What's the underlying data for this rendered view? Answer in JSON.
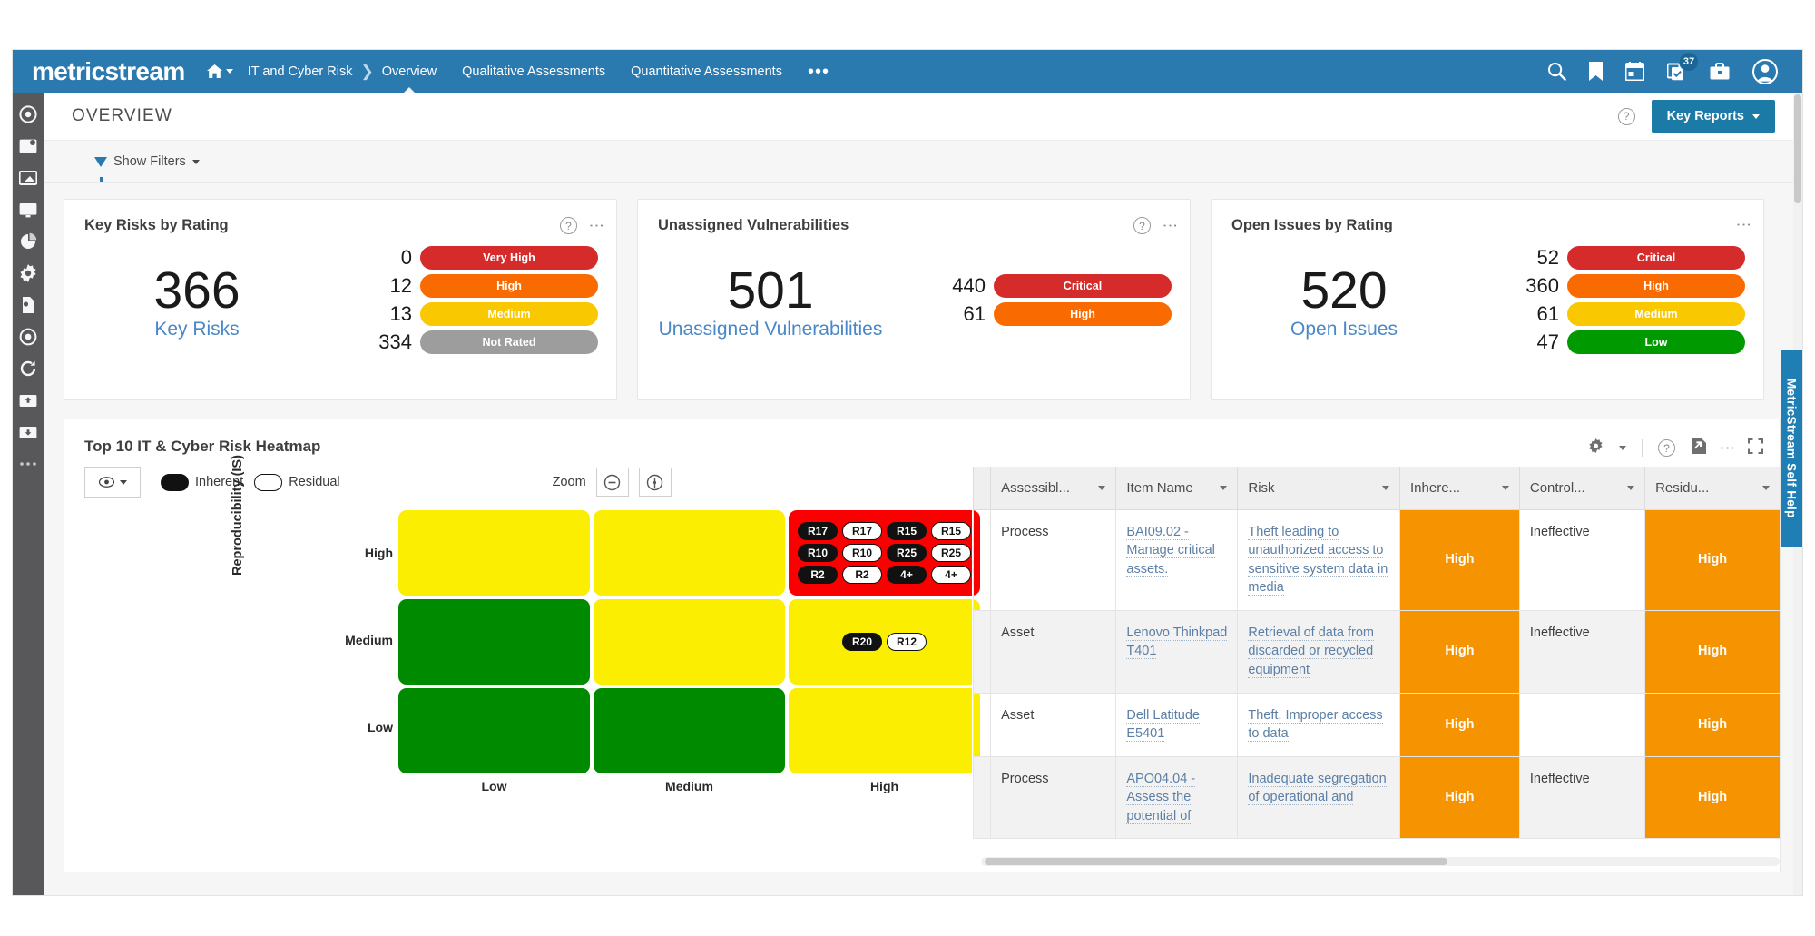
{
  "topbar": {
    "brand": "metricstream",
    "home_icon": "home-icon",
    "breadcrumb_root": "IT and Cyber Risk",
    "nav": [
      {
        "label": "Overview",
        "active": true
      },
      {
        "label": "Qualitative Assessments",
        "active": false
      },
      {
        "label": "Quantitative Assessments",
        "active": false
      }
    ],
    "more_label": "•••",
    "icons": [
      "search-icon",
      "bookmark-icon",
      "calendar-icon",
      "tasks-icon",
      "briefcase-icon",
      "user-avatar-icon"
    ],
    "task_badge": "37"
  },
  "page": {
    "title": "OVERVIEW",
    "help_label": "?",
    "key_reports_label": "Key Reports",
    "filters_label": "Show Filters"
  },
  "kpi_cards": [
    {
      "title": "Key Risks by Rating",
      "total": "366",
      "total_label": "Key Risks",
      "has_help": true,
      "bars": [
        {
          "value": "0",
          "label": "Very High",
          "color": "#d52b2b"
        },
        {
          "value": "12",
          "label": "High",
          "color": "#f96a00"
        },
        {
          "value": "13",
          "label": "Medium",
          "color": "#fac800"
        },
        {
          "value": "334",
          "label": "Not Rated",
          "color": "#9d9d9d"
        }
      ]
    },
    {
      "title": "Unassigned Vulnerabilities",
      "total": "501",
      "total_label": "Unassigned Vulnerabilities",
      "has_help": true,
      "bars": [
        {
          "value": "440",
          "label": "Critical",
          "color": "#d52b2b"
        },
        {
          "value": "61",
          "label": "High",
          "color": "#f96a00"
        }
      ]
    },
    {
      "title": "Open Issues by Rating",
      "total": "520",
      "total_label": "Open Issues",
      "has_help": false,
      "bars": [
        {
          "value": "52",
          "label": "Critical",
          "color": "#d52b2b"
        },
        {
          "value": "360",
          "label": "High",
          "color": "#f96a00"
        },
        {
          "value": "61",
          "label": "Medium",
          "color": "#fac800"
        },
        {
          "value": "47",
          "label": "Low",
          "color": "#009900"
        }
      ]
    }
  ],
  "heatmap_panel": {
    "title": "Top 10 IT & Cyber Risk Heatmap",
    "legend_inherent": "Inherent",
    "legend_residual": "Residual",
    "zoom_label": "Zoom",
    "zoom_out_icon": "zoom-out-icon",
    "zoom_reset_icon": "zoom-reset-icon",
    "eye_icon": "eye-icon",
    "tools": [
      "gear-icon",
      "help-icon",
      "export-icon",
      "kebab-icon",
      "fullscreen-icon"
    ]
  },
  "chart_data": {
    "type": "heatmap",
    "title": "Top 10 IT & Cyber Risk Heatmap",
    "ylabel": "Reproducibility (IS)",
    "xlabel": "",
    "y_categories": [
      "High",
      "Medium",
      "Low"
    ],
    "x_categories": [
      "Low",
      "Medium",
      "High"
    ],
    "legend": [
      "Inherent",
      "Residual"
    ],
    "cells": [
      {
        "row": "High",
        "col": "Low",
        "color": "#fbee00",
        "markers": []
      },
      {
        "row": "High",
        "col": "Medium",
        "color": "#fbee00",
        "markers": []
      },
      {
        "row": "High",
        "col": "High",
        "color": "#fb0000",
        "markers": [
          {
            "label": "R17",
            "type": "inherent"
          },
          {
            "label": "R17",
            "type": "residual"
          },
          {
            "label": "R15",
            "type": "inherent"
          },
          {
            "label": "R15",
            "type": "residual"
          },
          {
            "label": "R10",
            "type": "inherent"
          },
          {
            "label": "R10",
            "type": "residual"
          },
          {
            "label": "R25",
            "type": "inherent"
          },
          {
            "label": "R25",
            "type": "residual"
          },
          {
            "label": "R2",
            "type": "inherent"
          },
          {
            "label": "R2",
            "type": "residual"
          },
          {
            "label": "4+",
            "type": "inherent"
          },
          {
            "label": "4+",
            "type": "residual"
          }
        ]
      },
      {
        "row": "Medium",
        "col": "Low",
        "color": "#008a00",
        "markers": []
      },
      {
        "row": "Medium",
        "col": "Medium",
        "color": "#fbee00",
        "markers": []
      },
      {
        "row": "Medium",
        "col": "High",
        "color": "#fbee00",
        "markers": [
          {
            "label": "R20",
            "type": "inherent"
          },
          {
            "label": "R12",
            "type": "residual"
          }
        ]
      },
      {
        "row": "Low",
        "col": "Low",
        "color": "#008a00",
        "markers": []
      },
      {
        "row": "Low",
        "col": "Medium",
        "color": "#008a00",
        "markers": []
      },
      {
        "row": "Low",
        "col": "High",
        "color": "#fbee00",
        "markers": []
      }
    ]
  },
  "table": {
    "columns": [
      "Assessibl...",
      "Item Name",
      "Risk",
      "Inhere...",
      "Control...",
      "Residu..."
    ],
    "rows": [
      {
        "assessable": "Process",
        "item_name": "BAI09.02 - Manage critical assets.",
        "risk": "Theft leading to unauthorized access to sensitive system data in media",
        "inherent": "High",
        "control": "Ineffective",
        "residual": "High"
      },
      {
        "assessable": "Asset",
        "item_name": "Lenovo Thinkpad T401",
        "risk": "Retrieval of data from discarded or recycled equipment",
        "inherent": "High",
        "control": "Ineffective",
        "residual": "High"
      },
      {
        "assessable": "Asset",
        "item_name": "Dell Latitude E5401",
        "risk": "Theft, Improper access to data",
        "inherent": "High",
        "control": "",
        "residual": "High"
      },
      {
        "assessable": "Process",
        "item_name": "APO04.04 - Assess the potential of",
        "risk": "Inadequate segregation of operational and",
        "inherent": "High",
        "control": "Ineffective",
        "residual": "High"
      }
    ]
  },
  "help_tab": {
    "label": "MetricStream Self Help"
  },
  "colors": {
    "brand_blue": "#2a7ab0",
    "accent_button": "#1c7ba6",
    "rail_gray": "#58585a",
    "rating_high": "#f59300"
  }
}
